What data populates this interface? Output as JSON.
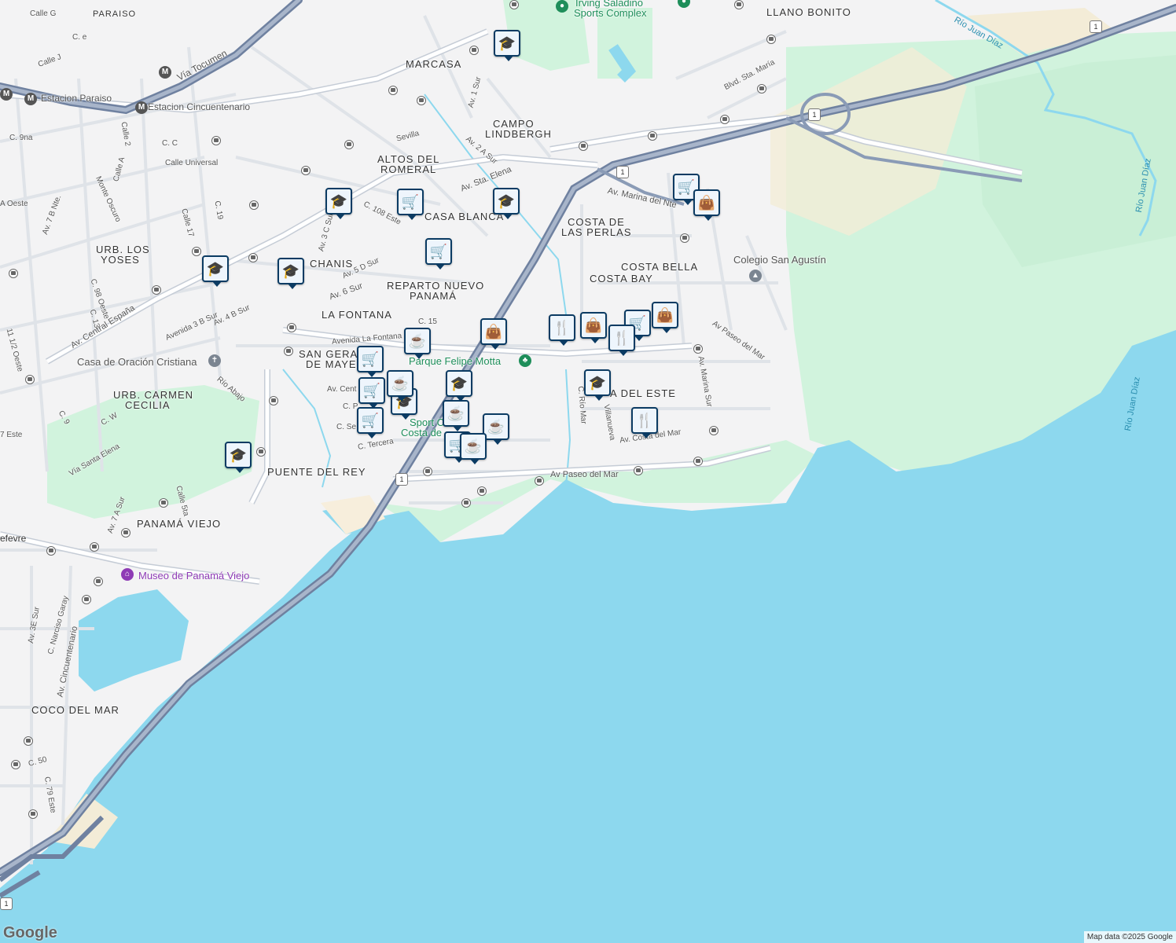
{
  "map": {
    "colors": {
      "water": "#8dd8ee",
      "land": "#f3f3f4",
      "park": "#d1f3dd",
      "highway": "#8a9bb6",
      "pin_border": "#0b3b63",
      "sand": "#f7eedc"
    },
    "neighborhoods": [
      {
        "text": "LLANO BONITO"
      },
      {
        "text": "PARAISO"
      },
      {
        "text": "MARCASA"
      },
      {
        "text": "CAMPO"
      },
      {
        "text": "LINDBERGH"
      },
      {
        "text": "ALTOS DEL"
      },
      {
        "text": "ROMERAL"
      },
      {
        "text": "CASA BLANCA"
      },
      {
        "text": "COSTA DE"
      },
      {
        "text": "LAS PERLAS"
      },
      {
        "text": "URB. LOS"
      },
      {
        "text": "YOSES"
      },
      {
        "text": "CHANIS"
      },
      {
        "text": "REPARTO NUEVO"
      },
      {
        "text": "PANAMÁ"
      },
      {
        "text": "COSTA BELLA"
      },
      {
        "text": "COSTA BAY"
      },
      {
        "text": "LA FONTANA"
      },
      {
        "text": "SAN GERA"
      },
      {
        "text": "DE MAYE"
      },
      {
        "text": "URB. CARMEN"
      },
      {
        "text": "CECILIA"
      },
      {
        "text": "A DEL ESTE"
      },
      {
        "text": "PUENTE DEL REY"
      },
      {
        "text": "PANAMÁ VIEJO"
      },
      {
        "text": "COCO DEL MAR"
      }
    ],
    "streets": [
      {
        "text": "Calle G"
      },
      {
        "text": "C. e"
      },
      {
        "text": "Calle J"
      },
      {
        "text": "Vía Tocumen"
      },
      {
        "text": "Estacion Paraiso"
      },
      {
        "text": "Estacion Cincuentenario"
      },
      {
        "text": "Calle 2"
      },
      {
        "text": "C. C"
      },
      {
        "text": "Calle Universal"
      },
      {
        "text": "Calle A"
      },
      {
        "text": "C. 9na"
      },
      {
        "text": "Monte Oscuro"
      },
      {
        "text": "Calle 17"
      },
      {
        "text": "C. 19"
      },
      {
        "text": "A Oeste"
      },
      {
        "text": "Av. 7 B Nte."
      },
      {
        "text": "Sevilla"
      },
      {
        "text": "Av. 1 Sur"
      },
      {
        "text": "Av. 2 A Sur"
      },
      {
        "text": "Av. Sta. Elena"
      },
      {
        "text": "C. 108 Este"
      },
      {
        "text": "Av. 3 C Sur"
      },
      {
        "text": "Av. 5 D Sur"
      },
      {
        "text": "Av. 6 Sur"
      },
      {
        "text": "C. 98 Oeste"
      },
      {
        "text": "C. 13"
      },
      {
        "text": "Av. Central España"
      },
      {
        "text": "Avenida 3 B Sur"
      },
      {
        "text": "Av. 4 B Sur"
      },
      {
        "text": "C. 15"
      },
      {
        "text": "Avenida La Fontana"
      },
      {
        "text": "Av. Marina del Nte"
      },
      {
        "text": "Blvd. Sta. María"
      },
      {
        "text": "Av Paseo del Mar"
      },
      {
        "text": "Av. Marina Sur"
      },
      {
        "text": "C. Río Mar"
      },
      {
        "text": "Villanueva"
      },
      {
        "text": "Av. Costa del Mar"
      },
      {
        "text": "Av. Cent"
      },
      {
        "text": "C. P"
      },
      {
        "text": "C. Se"
      },
      {
        "text": "C. Tercera"
      },
      {
        "text": "Río Abajo"
      },
      {
        "text": "Vía Santa Elena"
      },
      {
        "text": "C. W"
      },
      {
        "text": "C. 9"
      },
      {
        "text": "Calle 5ta"
      },
      {
        "text": "Av. 7 A Sur"
      },
      {
        "text": "efevre"
      },
      {
        "text": "C. Narciso Garay"
      },
      {
        "text": "Av. 3E Sur"
      },
      {
        "text": "Av. Cincuentenario"
      },
      {
        "text": "C. 50"
      },
      {
        "text": "C. 79 Este"
      },
      {
        "text": "Río Juan Díaz"
      },
      {
        "text": "11 1/2 Oeste"
      },
      {
        "text": "7 Este"
      }
    ],
    "places": [
      {
        "text": "Irving Saladino"
      },
      {
        "text": "Sports Complex"
      },
      {
        "text": "Colegio San Agustín"
      },
      {
        "text": "Casa de Oración Cristiana"
      },
      {
        "text": "Parque Felipe Motta"
      },
      {
        "text": "Sport C"
      },
      {
        "text": "Costa de"
      },
      {
        "text": "Museo de Panamá Viejo"
      }
    ],
    "shield": "1",
    "metro_label": "M",
    "pins": [
      {
        "icon": "school-icon"
      },
      {
        "icon": "school-icon"
      },
      {
        "icon": "school-icon"
      },
      {
        "icon": "school-icon"
      },
      {
        "icon": "school-icon"
      },
      {
        "icon": "school-icon"
      },
      {
        "icon": "school-icon"
      },
      {
        "icon": "school-icon"
      },
      {
        "icon": "cart-icon"
      },
      {
        "icon": "cart-icon"
      },
      {
        "icon": "cart-icon"
      },
      {
        "icon": "cart-icon"
      },
      {
        "icon": "cart-icon"
      },
      {
        "icon": "cart-icon"
      },
      {
        "icon": "cart-icon"
      },
      {
        "icon": "cart-icon"
      },
      {
        "icon": "cafe-icon"
      },
      {
        "icon": "cafe-icon"
      },
      {
        "icon": "cafe-icon"
      },
      {
        "icon": "cafe-icon"
      },
      {
        "icon": "cafe-icon"
      },
      {
        "icon": "shopping-bag-icon"
      },
      {
        "icon": "shopping-bag-icon"
      },
      {
        "icon": "shopping-bag-icon"
      },
      {
        "icon": "shopping-bag-icon"
      },
      {
        "icon": "restaurant-icon"
      },
      {
        "icon": "restaurant-icon"
      },
      {
        "icon": "restaurant-icon"
      }
    ]
  },
  "attribution": "Map data ©2025 Google",
  "logo": "Google"
}
